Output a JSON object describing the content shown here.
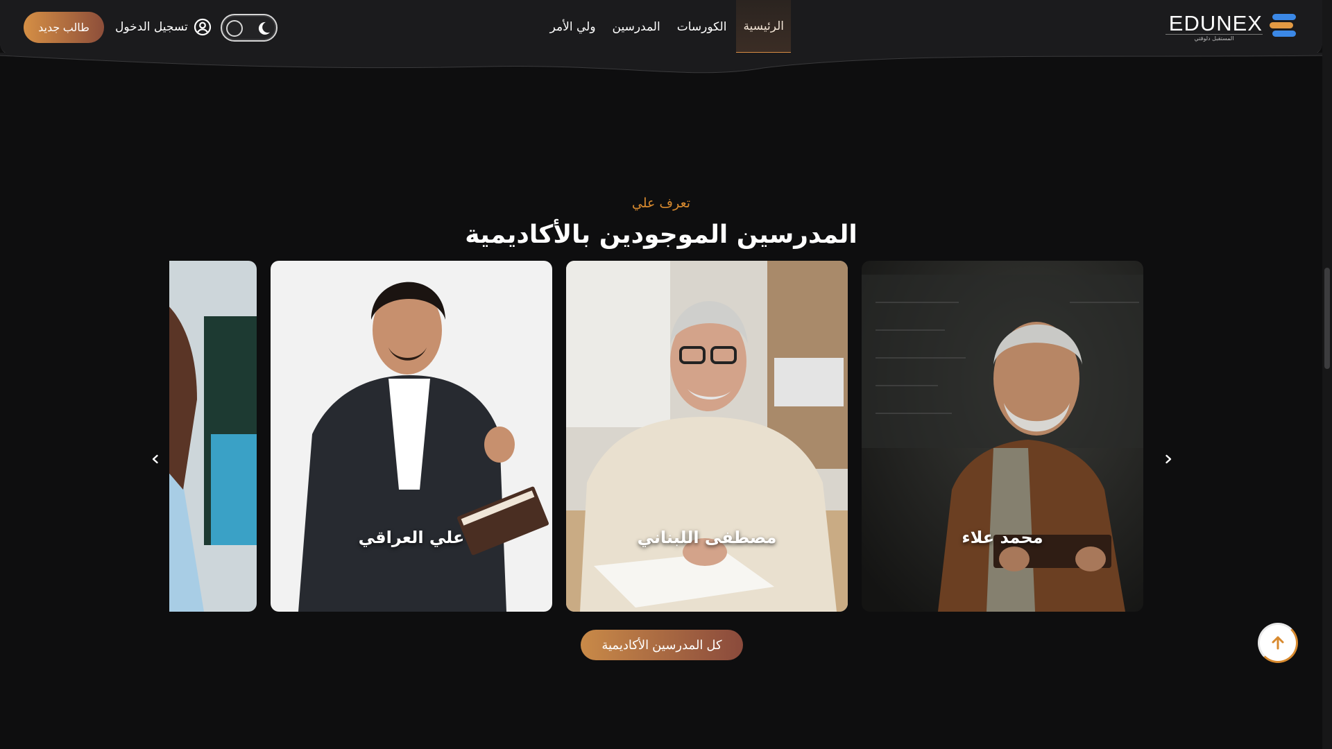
{
  "header": {
    "logo": {
      "text": "EDUNEX",
      "tagline": "المستقبل دلوقتي"
    },
    "nav": [
      {
        "label": "الرئيسية",
        "active": true
      },
      {
        "label": "الكورسات",
        "active": false
      },
      {
        "label": "المدرسين",
        "active": false
      },
      {
        "label": "ولي الأمر",
        "active": false
      }
    ],
    "login_label": "تسجيل الدخول",
    "new_student_label": "طالب جديد",
    "theme": "dark"
  },
  "section": {
    "subtitle": "تعرف علي",
    "title": "المدرسين الموجودين بالأكاديمية",
    "teachers": [
      {
        "name": "محمد علاء"
      },
      {
        "name": "مصطفى اللبناني"
      },
      {
        "name": "علي العراقي"
      },
      {
        "name": ""
      }
    ],
    "all_teachers_label": "كل المدرسين الأكاديمية"
  },
  "colors": {
    "accent": "#d88a2f",
    "background": "#0e0e0f",
    "header": "#1b1b1d",
    "button_gradient_start": "#d58f45",
    "button_gradient_end": "#8d4e3a"
  },
  "icons": {
    "logo": "edunex-logo-icon",
    "login": "user-circle-icon",
    "theme": "moon-icon",
    "prev": "chevron-left-icon",
    "next": "chevron-right-icon",
    "scroll_top": "arrow-up-icon"
  }
}
